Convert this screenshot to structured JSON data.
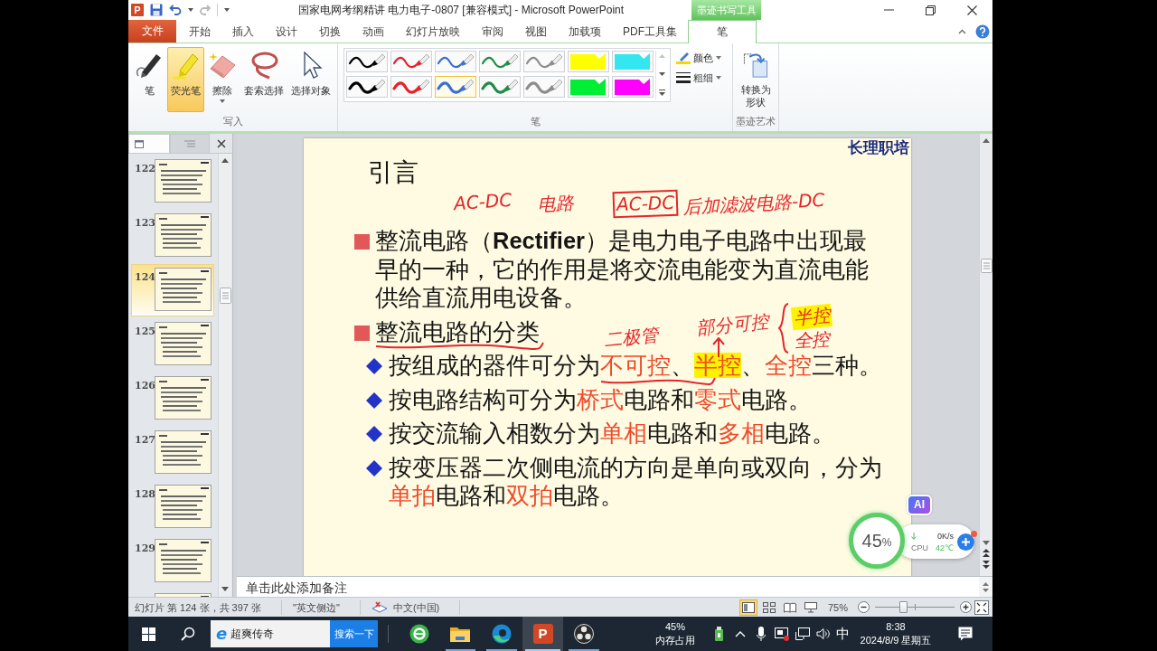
{
  "window": {
    "logo_letter": "P",
    "title": "国家电网考纲精讲 电力电子-0807 [兼容模式] - Microsoft PowerPoint",
    "context_header": "墨迹书写工具"
  },
  "ribbon_tabs": [
    {
      "label": "文件",
      "kind": "file",
      "selected": false
    },
    {
      "label": "开始",
      "kind": "normal",
      "selected": false
    },
    {
      "label": "插入",
      "kind": "normal",
      "selected": false
    },
    {
      "label": "设计",
      "kind": "normal",
      "selected": false
    },
    {
      "label": "切换",
      "kind": "normal",
      "selected": false
    },
    {
      "label": "动画",
      "kind": "normal",
      "selected": false
    },
    {
      "label": "幻灯片放映",
      "kind": "normal",
      "selected": false
    },
    {
      "label": "审阅",
      "kind": "normal",
      "selected": false
    },
    {
      "label": "视图",
      "kind": "normal",
      "selected": false
    },
    {
      "label": "加载项",
      "kind": "normal",
      "selected": false
    },
    {
      "label": "PDF工具集",
      "kind": "normal",
      "selected": false
    },
    {
      "label": "笔",
      "kind": "context",
      "selected": true
    }
  ],
  "ribbon_groups": [
    {
      "kind": "tools",
      "label": "写入",
      "tools": [
        {
          "kind": "pen",
          "label": "笔",
          "selected": false,
          "dropdown": false
        },
        {
          "kind": "highlighter",
          "label": "荧光笔",
          "selected": true,
          "dropdown": false
        },
        {
          "kind": "eraser",
          "label": "擦除",
          "selected": false,
          "dropdown": true
        },
        {
          "kind": "lasso",
          "label": "套索选择",
          "selected": false,
          "dropdown": false
        },
        {
          "kind": "select",
          "label": "选择对象",
          "selected": false,
          "dropdown": false
        }
      ]
    },
    {
      "kind": "gallery",
      "label": "笔",
      "pens": [
        {
          "kind": "thin",
          "color": "#000000",
          "selected": false
        },
        {
          "kind": "thin",
          "color": "#e8202a",
          "selected": false
        },
        {
          "kind": "thin",
          "color": "#3b6fd4",
          "selected": false
        },
        {
          "kind": "thin",
          "color": "#1e8c46",
          "selected": false
        },
        {
          "kind": "thin",
          "color": "#8c8c8c",
          "selected": false
        },
        {
          "kind": "highlighter",
          "color": "#ffff00",
          "selected": false
        },
        {
          "kind": "highlighter",
          "color": "#33e6f0",
          "selected": false
        },
        {
          "kind": "thick",
          "color": "#000000",
          "selected": false
        },
        {
          "kind": "thick",
          "color": "#e8202a",
          "selected": false
        },
        {
          "kind": "thick",
          "color": "#3b6fd4",
          "selected": true
        },
        {
          "kind": "thick",
          "color": "#1e8c46",
          "selected": false
        },
        {
          "kind": "thick",
          "color": "#8c8c8c",
          "selected": false
        },
        {
          "kind": "highlighter",
          "color": "#00ee33",
          "selected": false
        },
        {
          "kind": "highlighter",
          "color": "#ff00ff",
          "selected": false
        }
      ],
      "options": [
        {
          "kind": "color",
          "label": "颜色"
        },
        {
          "kind": "weight",
          "label": "粗细"
        }
      ]
    },
    {
      "kind": "tools",
      "label": "墨迹艺术",
      "tools": [
        {
          "kind": "convert",
          "label": "转换为形状",
          "selected": false,
          "dropdown": false
        }
      ]
    }
  ],
  "slides_panel": {
    "tabs": [
      {
        "kind": "slides",
        "selected": true
      },
      {
        "kind": "outline",
        "selected": false
      }
    ],
    "thumbnails": [
      {
        "number": "122",
        "selected": false
      },
      {
        "number": "123",
        "selected": false
      },
      {
        "number": "124",
        "selected": true
      },
      {
        "number": "125",
        "selected": false
      },
      {
        "number": "126",
        "selected": false
      },
      {
        "number": "127",
        "selected": false
      },
      {
        "number": "128",
        "selected": false
      },
      {
        "number": "129",
        "selected": false
      },
      {
        "selected": false
      }
    ]
  },
  "slide": {
    "title": "引言",
    "brand": "长理职培",
    "bullets": [
      {
        "kind": "main",
        "parts": [
          {
            "text": "整流电路（**Rectifier**）是电力电子电路中出现最早的一种，它的作用是将交流电能变为直流电能供给直流用电设备。",
            "accent": false,
            "highlighted": false
          }
        ]
      },
      {
        "kind": "main",
        "parts": [
          {
            "text": "整流电路的分类",
            "accent": false,
            "highlighted": false
          }
        ]
      },
      {
        "kind": "sub",
        "parts": [
          {
            "text": "按组成的器件可分为",
            "accent": false,
            "highlighted": false
          },
          {
            "text": "不可控",
            "accent": true,
            "highlighted": false
          },
          {
            "text": "、",
            "accent": false,
            "highlighted": false
          },
          {
            "text": "半控",
            "accent": true,
            "highlighted": true
          },
          {
            "text": "、",
            "accent": false,
            "highlighted": false
          },
          {
            "text": "全控",
            "accent": true,
            "highlighted": false
          },
          {
            "text": "三种。",
            "accent": false,
            "highlighted": false
          }
        ]
      },
      {
        "kind": "sub",
        "parts": [
          {
            "text": "按电路结构可分为",
            "accent": false,
            "highlighted": false
          },
          {
            "text": "桥式",
            "accent": true,
            "highlighted": false
          },
          {
            "text": "电路和",
            "accent": false,
            "highlighted": false
          },
          {
            "text": "零式",
            "accent": true,
            "highlighted": false
          },
          {
            "text": "电路。",
            "accent": false,
            "highlighted": false
          }
        ]
      },
      {
        "kind": "sub",
        "parts": [
          {
            "text": "按交流输入相数分为",
            "accent": false,
            "highlighted": false
          },
          {
            "text": "单相",
            "accent": true,
            "highlighted": false
          },
          {
            "text": "电路和",
            "accent": false,
            "highlighted": false
          },
          {
            "text": "多相",
            "accent": true,
            "highlighted": false
          },
          {
            "text": "电路。",
            "accent": false,
            "highlighted": false
          }
        ]
      },
      {
        "kind": "sub",
        "parts": [
          {
            "text": "按变压器二次侧电流的方向是单向或双向，分为",
            "accent": false,
            "highlighted": false
          },
          {
            "text": "单拍",
            "accent": true,
            "highlighted": false
          },
          {
            "text": "电路和",
            "accent": false,
            "highlighted": false
          },
          {
            "text": "双拍",
            "accent": true,
            "highlighted": false
          },
          {
            "text": "电路。",
            "accent": false,
            "highlighted": false
          }
        ]
      }
    ],
    "ink": [
      {
        "kind": "text",
        "text": "AC-DC",
        "boxed": false,
        "highlighted": false
      },
      {
        "kind": "text",
        "text": "电路",
        "boxed": false,
        "highlighted": false
      },
      {
        "kind": "text",
        "text": "AC-DC",
        "boxed": true,
        "highlighted": false
      },
      {
        "kind": "text",
        "text": "后加滤波电路-DC",
        "boxed": false,
        "highlighted": false
      },
      {
        "kind": "text",
        "text": "半控",
        "boxed": false,
        "highlighted": true
      },
      {
        "kind": "text",
        "text": "部分可控",
        "boxed": false,
        "highlighted": false
      },
      {
        "kind": "text",
        "text": "全控",
        "boxed": false,
        "highlighted": false
      },
      {
        "kind": "text",
        "text": "二极管",
        "boxed": false,
        "highlighted": false
      },
      {
        "kind": "underline"
      },
      {
        "kind": "underline"
      },
      {
        "kind": "arrow"
      },
      {
        "kind": "brace"
      }
    ]
  },
  "notes": {
    "placeholder": "单击此处添加备注"
  },
  "status_bar": {
    "slide_info": "幻灯片 第 124 张，共 397 张",
    "theme": "\"英文侧边\"",
    "language": "中文(中国)",
    "views": [
      {
        "kind": "normal",
        "selected": true
      },
      {
        "kind": "sorter",
        "selected": false
      },
      {
        "kind": "reading",
        "selected": false
      },
      {
        "kind": "show",
        "selected": false
      }
    ],
    "zoom": "75%",
    "zoom_slider": {
      "level": 0.35
    }
  },
  "taskbar": {
    "search": {
      "logo_letter": "e",
      "value": "超爽传奇",
      "button": "搜索一下"
    },
    "apps": [
      {
        "kind": "ring",
        "running": false,
        "selected": false
      },
      {
        "kind": "folder",
        "running": true,
        "selected": false
      },
      {
        "kind": "swirl",
        "running": true,
        "selected": false
      },
      {
        "kind": "presentation",
        "letter": "P",
        "running": true,
        "selected": true
      },
      {
        "kind": "aperture",
        "running": true,
        "selected": false
      }
    ],
    "memory": {
      "value": "45%",
      "label": "内存占用"
    },
    "ime": "中",
    "time": "8:38",
    "date": "2024/8/9 星期五"
  },
  "widget": {
    "ai": "AI",
    "gauge_value": "45",
    "gauge_unit": "%",
    "rate": "0K/s",
    "cpu_label": "CPU",
    "cpu_temp": "42℃"
  }
}
